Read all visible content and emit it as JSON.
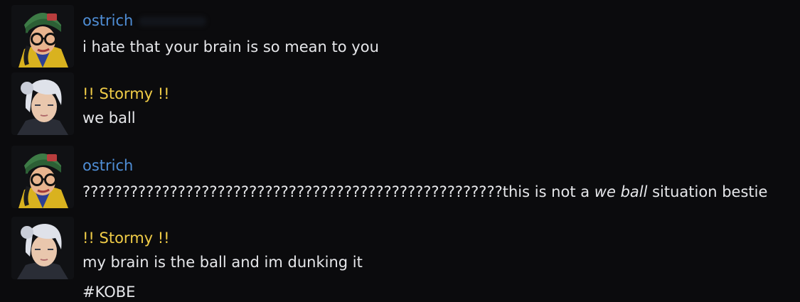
{
  "messages": [
    {
      "author": "ostrich",
      "lines": [
        "i hate that your brain is so mean to you"
      ]
    },
    {
      "author": "!! Stormy !!",
      "lines": [
        "we ball"
      ]
    },
    {
      "author": "ostrich",
      "line_parts": {
        "pre": "?????????????????????????????????????????????????????this is not a ",
        "italic": "we ball",
        "post": " situation bestie"
      }
    },
    {
      "author": "!! Stormy !!",
      "lines": [
        "my brain is the ball and im dunking it",
        "#KOBE"
      ]
    }
  ],
  "colors": {
    "background": "#0b0b0d",
    "ostrich_name": "#4f8ed6",
    "stormy_name": "#f0cc47",
    "text": "#e6e7ea"
  },
  "icons": {
    "ostrich_avatar": "green-beanie-glasses-character",
    "stormy_avatar": "white-hair-character"
  }
}
